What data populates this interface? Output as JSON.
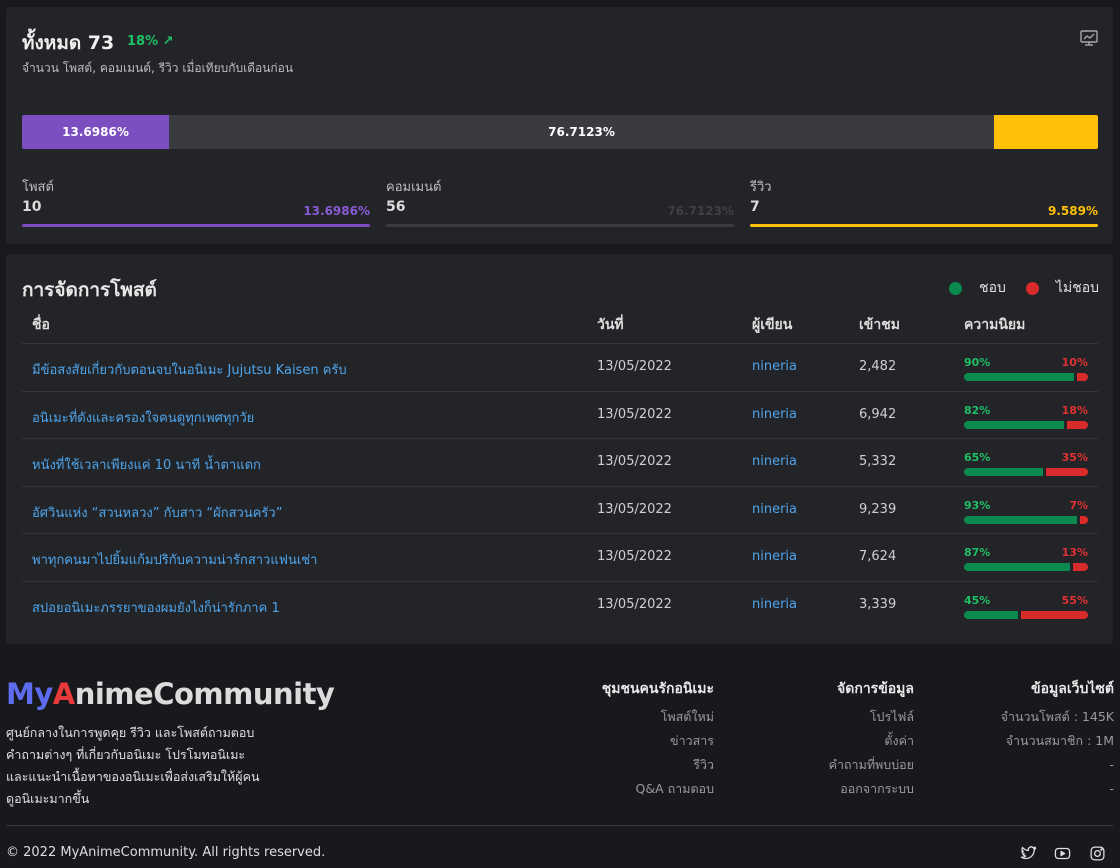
{
  "stats": {
    "title": "ทั้งหมด 73",
    "growth": "18%",
    "growth_arrow": "↗",
    "subtitle": "จำนวน โพสต์, คอมเมนต์, รีวิว เมื่อเทียบกับเดือนก่อน",
    "chart_icon": "presentation-chart-icon",
    "bar_labels": {
      "posts": "13.6986%",
      "comments": "76.7123%",
      "reviews": ""
    },
    "bar_fractions": {
      "posts": 0.136986,
      "comments": 0.767123,
      "reviews": 0.09589
    },
    "metrics": [
      {
        "label": "โพสต์",
        "value": "10",
        "pct": "13.6986%",
        "color": "#7b4fc0"
      },
      {
        "label": "คอมเมนต์",
        "value": "56",
        "pct": "76.7123%",
        "color": "#3a3c42"
      },
      {
        "label": "รีวิว",
        "value": "7",
        "pct": "9.589%",
        "color": "#ffc107"
      }
    ]
  },
  "posts": {
    "title": "การจัดการโพสต์",
    "legend": {
      "like": "ชอบ",
      "dislike": "ไม่ชอบ",
      "like_color": "#0b8a4f",
      "dislike_color": "#d92b2b"
    },
    "headers": {
      "name": "ชื่อ",
      "date": "วันที่",
      "author": "ผู้เขียน",
      "views": "เข้าชม",
      "popularity": "ความนิยม"
    },
    "rows": [
      {
        "title": "มีข้อสงสัยเกี่ยวกับตอนจบในอนิเมะ Jujutsu Kaisen ครับ",
        "date": "13/05/2022",
        "author": "nineria",
        "views": "2,482",
        "like": "90%",
        "dislike": "10%",
        "like_frac": 0.9
      },
      {
        "title": "อนิเมะที่ดังและครองใจคนดูทุกเพศทุกวัย",
        "date": "13/05/2022",
        "author": "nineria",
        "views": "6,942",
        "like": "82%",
        "dislike": "18%",
        "like_frac": 0.82
      },
      {
        "title": "หนังที่ใช้เวลาเพียงแค่ 10 นาที น้ำตาแตก",
        "date": "13/05/2022",
        "author": "nineria",
        "views": "5,332",
        "like": "65%",
        "dislike": "35%",
        "like_frac": 0.65
      },
      {
        "title": "อัศวินแห่ง “สวนหลวง” กับสาว “ผักสวนครัว”",
        "date": "13/05/2022",
        "author": "nineria",
        "views": "9,239",
        "like": "93%",
        "dislike": "7%",
        "like_frac": 0.93
      },
      {
        "title": "พาทุกคนมาไปยิ้มแก้มปริกับความน่ารักสาวแฟนเช่า",
        "date": "13/05/2022",
        "author": "nineria",
        "views": "7,624",
        "like": "87%",
        "dislike": "13%",
        "like_frac": 0.87
      },
      {
        "title": "สปอยอนิเมะภรรยาของผมยังไงก็น่ารักภาค 1",
        "date": "13/05/2022",
        "author": "nineria",
        "views": "3,339",
        "like": "45%",
        "dislike": "55%",
        "like_frac": 0.45
      }
    ]
  },
  "footer": {
    "logo_my": "My",
    "logo_a": "A",
    "logo_rest": "nimeCommunity",
    "about": "ศูนย์กลางในการพูดคุย รีวิว และโพสต์ถามตอบคำถามต่างๆ ที่เกี่ยวกับอนิเมะ โปรโมทอนิเมะ และแนะนำเนื้อหาของอนิเมะเพื่อส่งเสริมให้ผู้คนดูอนิเมะมากขึ้น",
    "col1": {
      "title": "ชุมชนคนรักอนิเมะ",
      "items": [
        "โพสต์ใหม่",
        "ข่าวสาร",
        "รีวิว",
        "Q&A ถามตอบ"
      ]
    },
    "col2": {
      "title": "จัดการข้อมูล",
      "items": [
        "โปรไฟล์",
        "ตั้งค่า",
        "คำถามที่พบบ่อย",
        "ออกจากระบบ"
      ]
    },
    "col3": {
      "title": "ข้อมูลเว็บไซต์",
      "items": [
        "จำนวนโพสต์ : 145K",
        "จำนวนสมาชิก : 1M",
        "-",
        "-"
      ]
    },
    "copyright": "© 2022 MyAnimeCommunity. All rights reserved.",
    "social": [
      "twitter-icon",
      "youtube-icon",
      "instagram-icon"
    ]
  }
}
